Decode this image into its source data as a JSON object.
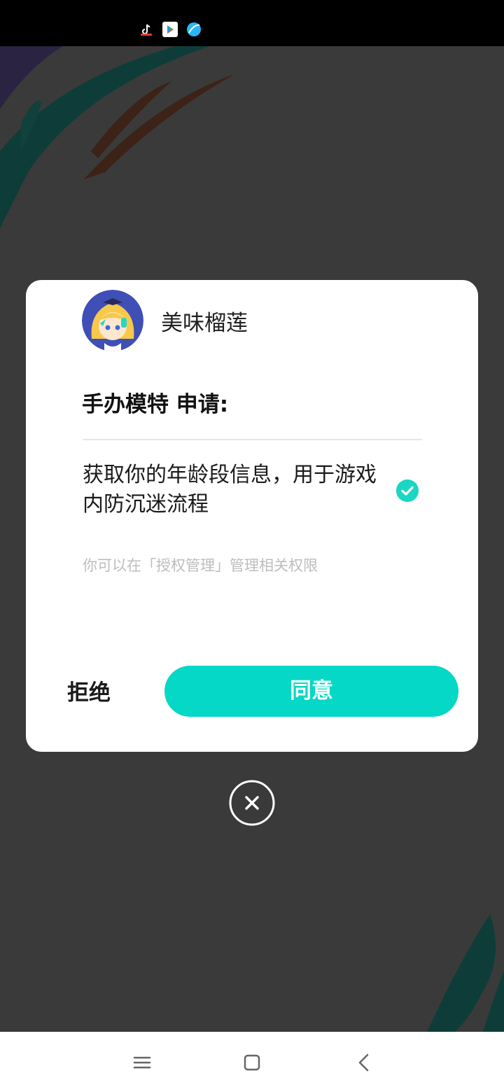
{
  "status_bar": {
    "icons": [
      "tiktok-icon",
      "play-store-icon",
      "browser-icon"
    ]
  },
  "dialog": {
    "app_name": "美味榴莲",
    "request_title": "手办模特 申请:",
    "permission_text": "获取你的年龄段信息，用于游戏内防沉迷流程",
    "permission_checked": true,
    "hint": "你可以在「授权管理」管理相关权限",
    "reject_label": "拒绝",
    "agree_label": "同意"
  },
  "colors": {
    "accent": "#05d8c6",
    "check": "#1ad6c2",
    "overlay": "#3a3a3a"
  },
  "nav_bar": {
    "buttons": [
      "menu-icon",
      "home-icon",
      "back-icon"
    ]
  }
}
